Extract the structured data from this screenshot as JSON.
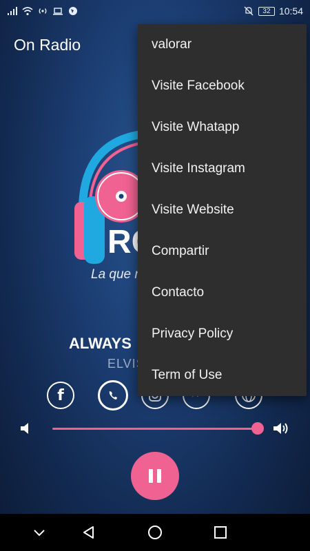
{
  "status_bar": {
    "battery": "32",
    "time": "10:54"
  },
  "app": {
    "title": "On Radio"
  },
  "logo": {
    "letters": "RC",
    "tagline": "La que n"
  },
  "player": {
    "song_title": "ALWAYS",
    "artist": "ELVIS",
    "volume_level": 1.0,
    "state": "playing"
  },
  "social": {
    "facebook_glyph": "f"
  },
  "menu": {
    "items": [
      {
        "label": "valorar"
      },
      {
        "label": "Visite Facebook"
      },
      {
        "label": "Visite Whatapp"
      },
      {
        "label": "Visite Instagram"
      },
      {
        "label": "Visite Website"
      },
      {
        "label": "Compartir"
      },
      {
        "label": "Contacto"
      },
      {
        "label": "Privacy Policy"
      },
      {
        "label": "Term of Use"
      }
    ]
  },
  "colors": {
    "accent": "#f06292",
    "headphones": "#1fa9e0",
    "menu_bg": "#2e2e2e"
  },
  "icons": [
    "signal-icon",
    "wifi-icon",
    "hotspot-icon",
    "laptop-icon",
    "globe-icon",
    "mute-icon",
    "battery-icon",
    "facebook-icon",
    "whatsapp-icon",
    "instagram-icon",
    "messenger-icon",
    "web-icon",
    "volume-low-icon",
    "volume-high-icon",
    "pause-icon",
    "nav-down-icon",
    "nav-back-icon",
    "nav-home-icon",
    "nav-recents-icon"
  ]
}
